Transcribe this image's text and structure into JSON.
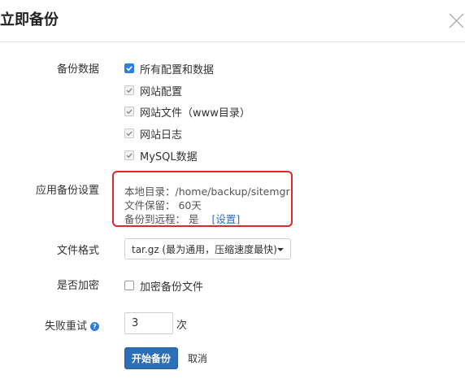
{
  "dialog": {
    "title": "立即备份",
    "close_icon": "close-icon"
  },
  "backup_data": {
    "label": "备份数据",
    "options": [
      {
        "label": "所有配置和数据",
        "checked": true,
        "state": "checked-blue"
      },
      {
        "label": "网站配置",
        "checked": true,
        "state": "checked-gray"
      },
      {
        "label": "网站文件（www目录）",
        "checked": true,
        "state": "checked-gray"
      },
      {
        "label": "网站日志",
        "checked": true,
        "state": "checked-gray"
      },
      {
        "label": "MySQL数据",
        "checked": true,
        "state": "checked-gray"
      }
    ]
  },
  "backup_settings": {
    "label": "应用备份设置",
    "local_dir": "本地目录：/home/backup/sitemgr",
    "retention": "文件保留： 60天",
    "remote": "备份到远程： 是",
    "settings_link": "[设置]"
  },
  "file_format": {
    "label": "文件格式",
    "selected": "tar.gz (最为通用，压缩速度最快)"
  },
  "encrypt": {
    "label": "是否加密",
    "option": "加密备份文件",
    "checked": false
  },
  "retry": {
    "label": "失败重试",
    "help_icon": "help-icon",
    "value": "3",
    "unit": "次"
  },
  "actions": {
    "start": "开始备份",
    "cancel": "取消"
  },
  "colors": {
    "accent": "#2c7ee2",
    "primary_button": "#2c6fb7",
    "highlight_border": "#e02828"
  }
}
